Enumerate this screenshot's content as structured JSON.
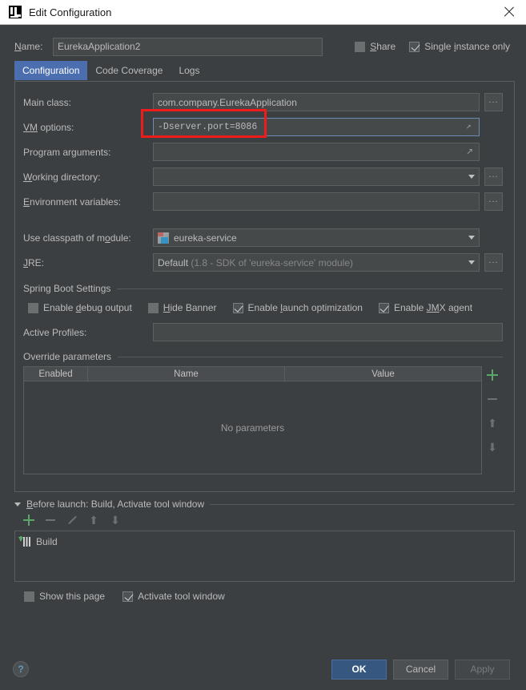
{
  "window": {
    "title": "Edit Configuration",
    "app_icon": "intellij-idea-logo-icon",
    "close_icon": "close-icon"
  },
  "name_row": {
    "label": "Name:",
    "label_mnemonic": "N",
    "value": "EurekaApplication2",
    "share": {
      "label": "Share",
      "mnemonic": "S",
      "checked": false
    },
    "single_instance": {
      "label": "Single instance only",
      "mnemonic": "i",
      "checked": true
    }
  },
  "tabs": [
    {
      "label": "Configuration",
      "active": true
    },
    {
      "label": "Code Coverage",
      "active": false
    },
    {
      "label": "Logs",
      "active": false
    }
  ],
  "fields": {
    "main_class": {
      "label": "Main class:",
      "value": "com.company.EurekaApplication",
      "browse_label": "...",
      "browse_icon": "ellipsis-icon"
    },
    "vm_options": {
      "label": "VM options:",
      "label_mnemonic": "VM",
      "value": "-Dserver.port=8086",
      "expand_icon": "expand-arrows-icon",
      "highlighted": true
    },
    "program_arguments": {
      "label": "Program arguments:",
      "label_mnemonic": "g",
      "value": "",
      "expand_icon": "expand-arrows-icon"
    },
    "working_directory": {
      "label": "Working directory:",
      "label_mnemonic": "W",
      "value": "",
      "dropdown_icon": "chevron-down-icon",
      "browse_label": "...",
      "browse_icon": "ellipsis-icon"
    },
    "environment_variables": {
      "label": "Environment variables:",
      "label_mnemonic": "E",
      "value": "",
      "browse_label": "...",
      "browse_icon": "ellipsis-icon"
    },
    "classpath_module": {
      "label": "Use classpath of module:",
      "label_mnemonic": "o",
      "value": "eureka-service",
      "module_icon": "module-icon",
      "dropdown_icon": "chevron-down-icon"
    },
    "jre": {
      "label": "JRE:",
      "label_mnemonic": "J",
      "value": "Default",
      "value_hint": "(1.8 - SDK of 'eureka-service' module)",
      "dropdown_icon": "chevron-down-icon",
      "browse_label": "...",
      "browse_icon": "ellipsis-icon"
    }
  },
  "spring_boot": {
    "section_title": "Spring Boot Settings",
    "checkboxes": [
      {
        "label": "Enable debug output",
        "mnemonic": "d",
        "checked": false
      },
      {
        "label": "Hide Banner",
        "mnemonic": "H",
        "checked": false
      },
      {
        "label": "Enable launch optimization",
        "mnemonic": "l",
        "checked": true
      },
      {
        "label": "Enable JMX agent",
        "mnemonic": "JM",
        "checked": true
      }
    ],
    "active_profiles": {
      "label": "Active Profiles:",
      "value": ""
    }
  },
  "override_parameters": {
    "section_title": "Override parameters",
    "columns": [
      "Enabled",
      "Name",
      "Value"
    ],
    "rows": [],
    "empty_text": "No parameters",
    "tools": [
      {
        "name": "add",
        "icon": "plus-icon",
        "enabled": true
      },
      {
        "name": "remove",
        "icon": "minus-icon",
        "enabled": false
      },
      {
        "name": "move-up",
        "icon": "arrow-up-icon",
        "glyph": "⬆",
        "enabled": false
      },
      {
        "name": "move-down",
        "icon": "arrow-down-icon",
        "glyph": "⬇",
        "enabled": false
      }
    ]
  },
  "before_launch": {
    "title": "Before launch: Build, Activate tool window",
    "title_mnemonic": "B",
    "collapse_icon": "triangle-down-icon",
    "toolbar": [
      {
        "name": "add",
        "icon": "plus-icon",
        "enabled": true
      },
      {
        "name": "remove",
        "icon": "minus-icon",
        "enabled": false
      },
      {
        "name": "edit",
        "icon": "pencil-icon",
        "enabled": false
      },
      {
        "name": "move-up",
        "icon": "arrow-up-icon",
        "glyph": "⬆",
        "enabled": false
      },
      {
        "name": "move-down",
        "icon": "arrow-down-icon",
        "glyph": "⬇",
        "enabled": false
      }
    ],
    "items": [
      {
        "label": "Build",
        "icon": "build-icon"
      }
    ],
    "show_this_page": {
      "label": "Show this page",
      "checked": false
    },
    "activate_tool_window": {
      "label": "Activate tool window",
      "checked": true
    }
  },
  "footer": {
    "help_label": "?",
    "help_icon": "help-icon",
    "ok": "OK",
    "cancel": "Cancel",
    "apply": "Apply",
    "apply_enabled": false
  },
  "colors": {
    "background": "#3c3f41",
    "field_background": "#45494a",
    "accent_blue": "#4b6eaf",
    "primary_button": "#365880",
    "annotation_red": "#f01c1c",
    "green_icon": "#59a869",
    "titlebar": "#ffffff"
  }
}
